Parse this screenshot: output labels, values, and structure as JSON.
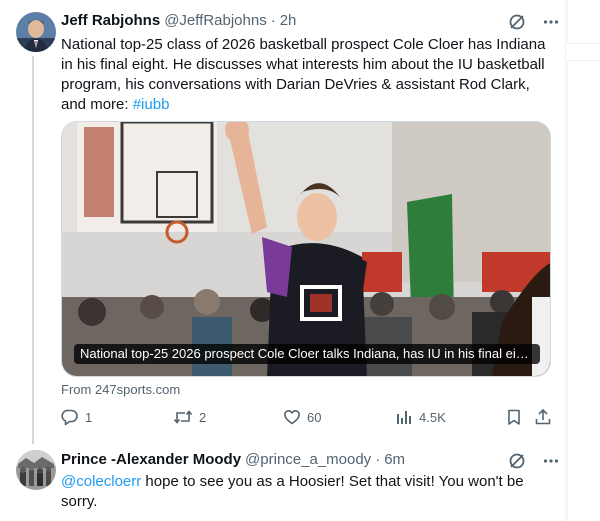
{
  "post": {
    "author_name": "Jeff Rabjohns",
    "handle": "@JeffRabjohns",
    "separator": "·",
    "time": "2h",
    "text_main": "National top-25 class of 2026 basketball prospect Cole Cloer has Indiana in his final eight. He discusses what interests him about the IU basketball program, his conversations with Darian DeVries & assistant Rod Clark, and more: ",
    "hashtag": "#iubb",
    "card_caption": "National top-25 2026 prospect Cole Cloer talks Indiana, has IU in his final eigh...",
    "card_source": "From 247sports.com",
    "stats": {
      "replies": "1",
      "reposts": "2",
      "likes": "60",
      "views": "4.5K"
    }
  },
  "reply": {
    "author_name": "Prince -Alexander Moody",
    "handle": "@prince_a_moody",
    "separator": "·",
    "time": "6m",
    "mention": "@colecloerr",
    "text": " hope to see you as a Hoosier!  Set that visit! You won't be sorry."
  },
  "icons": {
    "grok": "grok-icon",
    "more": "more-icon",
    "reply": "reply-icon",
    "repost": "repost-icon",
    "like": "heart-icon",
    "views": "views-icon",
    "bookmark": "bookmark-icon",
    "share": "share-icon"
  },
  "colors": {
    "link": "#1d9bf0",
    "secondary_text": "#536471",
    "primary_text": "#0f1419"
  }
}
